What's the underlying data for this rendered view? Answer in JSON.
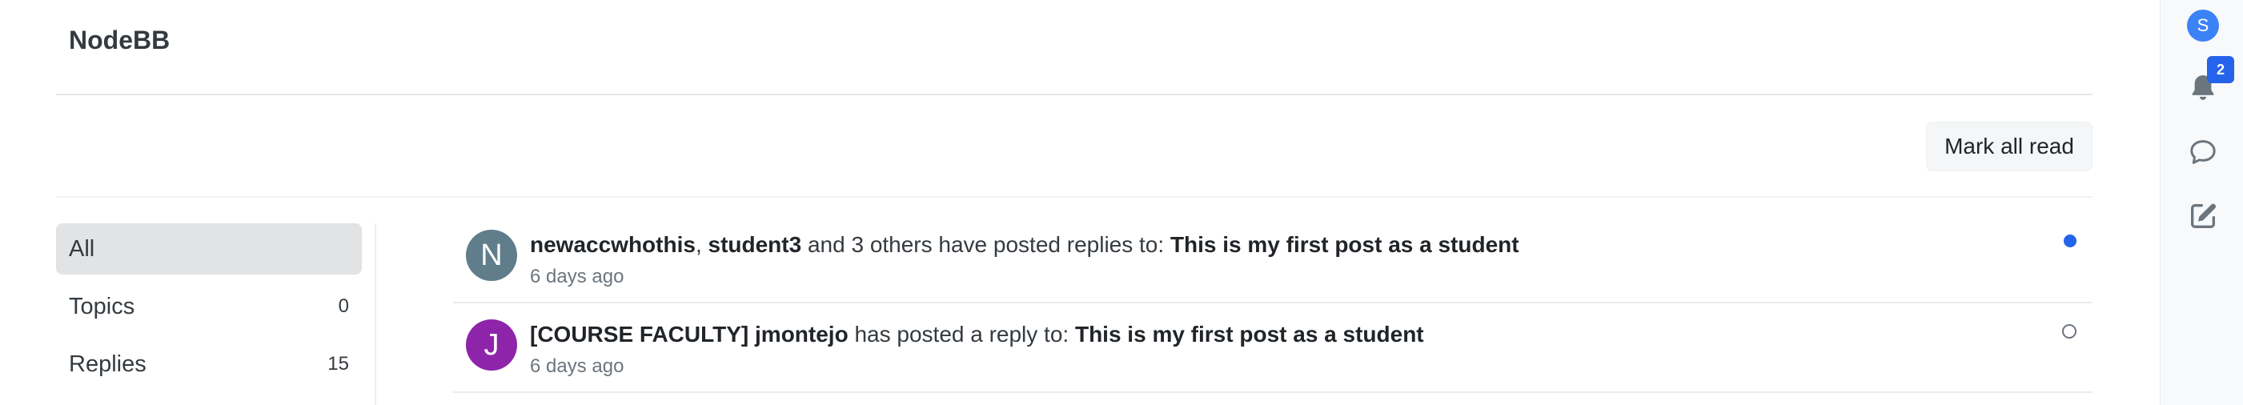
{
  "brand": {
    "title": "NodeBB"
  },
  "toolbar": {
    "mark_all_read_label": "Mark all read"
  },
  "filters": [
    {
      "label": "All",
      "count": "",
      "active": true
    },
    {
      "label": "Topics",
      "count": "0",
      "active": false
    },
    {
      "label": "Replies",
      "count": "15",
      "active": false
    }
  ],
  "notifications": [
    {
      "avatar_letter": "N",
      "avatar_color": "#607d8b",
      "user1": "newaccwhothis",
      "sep": ", ",
      "user2": "student3",
      "action": " and 3 others have posted replies to: ",
      "topic": "This is my first post as a student",
      "time": "6 days ago",
      "read": false
    },
    {
      "avatar_letter": "J",
      "avatar_color": "#8e24aa",
      "user1": "[COURSE FACULTY] jmontejo",
      "action": " has posted a reply to: ",
      "topic": "This is my first post as a student",
      "time": "6 days ago",
      "read": true
    }
  ],
  "right_rail": {
    "user_avatar_letter": "S",
    "user_avatar_color": "#3b82f6",
    "notification_badge": "2",
    "icons": [
      "bell-icon",
      "chat-icon",
      "compose-icon"
    ]
  },
  "colors": {
    "accent": "#2563eb",
    "active_filter_bg": "#e2e3e5"
  }
}
